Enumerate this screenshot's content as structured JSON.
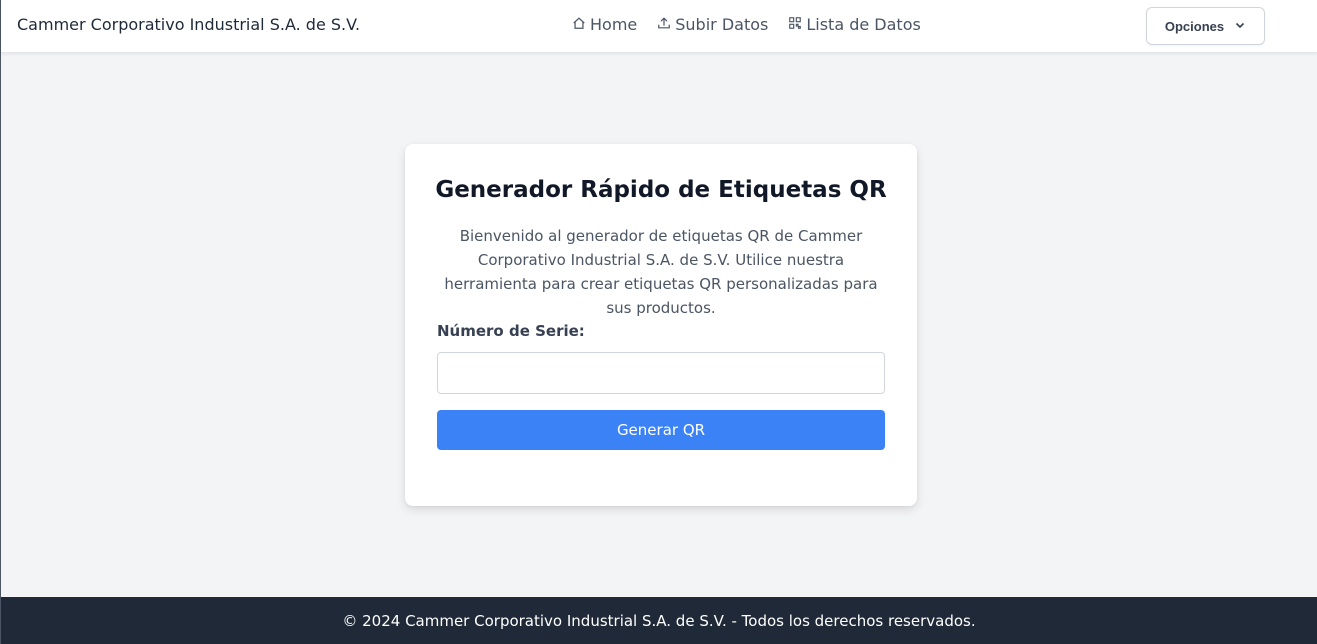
{
  "navbar": {
    "brand": "Cammer Corporativo Industrial S.A. de S.V.",
    "links": [
      {
        "label": "Home",
        "icon": "home-icon"
      },
      {
        "label": "Subir Datos",
        "icon": "upload-icon"
      },
      {
        "label": "Lista de Datos",
        "icon": "qr-grid-icon"
      }
    ],
    "options_label": "Opciones"
  },
  "card": {
    "title": "Generador Rápido de Etiquetas QR",
    "description": "Bienvenido al generador de etiquetas QR de Cammer Corporativo Industrial S.A. de S.V. Utilice nuestra herramienta para crear etiquetas QR personalizadas para sus productos.",
    "serial_label": "Número de Serie:",
    "serial_value": "",
    "button_label": "Generar QR"
  },
  "footer": {
    "text": "© 2024 Cammer Corporativo Industrial S.A. de S.V. - Todos los derechos reservados."
  },
  "colors": {
    "accent": "#3b82f6",
    "footer_bg": "#1f2937",
    "page_bg": "#f3f4f6"
  }
}
